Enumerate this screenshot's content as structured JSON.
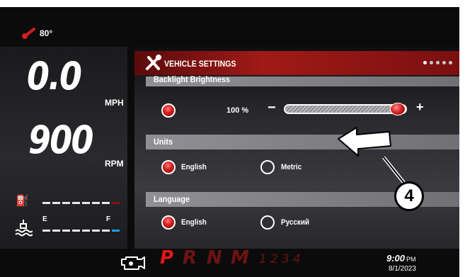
{
  "status": {
    "temperature": "80°"
  },
  "gauges": {
    "speed_value": "0.0",
    "speed_unit": "MPH",
    "rpm_value": "900",
    "rpm_unit": "RPM",
    "fuel_level": 0.875,
    "fluid_empty_label": "E",
    "fluid_full_label": "F",
    "fluid_level": 1.0
  },
  "settings": {
    "title": "VEHICLE SETTINGS",
    "page_indicator": {
      "current": 1,
      "total": 5
    },
    "backlight": {
      "title": "Backlight Brightness",
      "value_text": "100 %",
      "value": 1.0,
      "minus": "−",
      "plus": "+"
    },
    "units": {
      "title": "Units",
      "options": [
        "English",
        "Metric"
      ],
      "selected": "English"
    },
    "language": {
      "title": "Language",
      "options": [
        "English",
        "Русский"
      ],
      "selected": "English"
    }
  },
  "callout": {
    "label": "4"
  },
  "transmission": {
    "gears": [
      "P",
      "R",
      "N",
      "M"
    ],
    "manual_gears": [
      "1",
      "2",
      "3",
      "4"
    ],
    "selected": "P"
  },
  "clock": {
    "time": "9:00",
    "ampm": "PM",
    "date": "8/1/2023"
  },
  "colors": {
    "accent_red": "#d21d1d",
    "header_red": "#a01a17",
    "fluid_blue": "#1e9be6"
  }
}
